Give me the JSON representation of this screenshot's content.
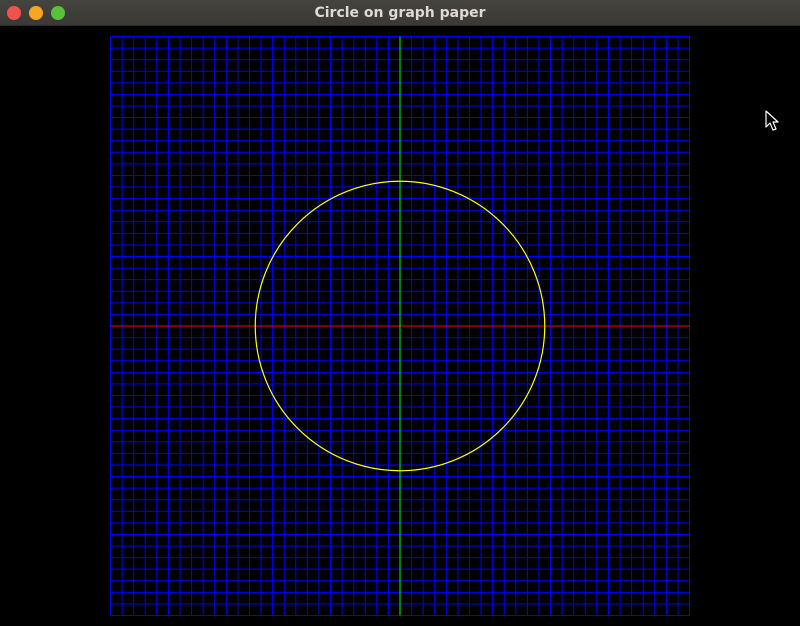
{
  "window": {
    "title": "Circle on graph paper",
    "buttons": {
      "close": {
        "icon": "close-icon",
        "color": "#ef5350"
      },
      "minimize": {
        "icon": "minimize-icon",
        "color": "#f5a623"
      },
      "maximize": {
        "icon": "maximize-icon",
        "color": "#58c13a"
      }
    }
  },
  "graph": {
    "x_range": [
      -25,
      25
    ],
    "y_range": [
      -25,
      25
    ],
    "grid_step": 1,
    "grid_on": true,
    "circle": {
      "center": [
        0,
        0
      ],
      "radius": 12.5
    },
    "colors": {
      "background": "#000000",
      "grid": "#0000ff",
      "x_axis": "#ff0000",
      "y_axis": "#00ff00",
      "circle": "#ffff00"
    }
  },
  "cursor": {
    "icon": "mouse-pointer-icon"
  }
}
